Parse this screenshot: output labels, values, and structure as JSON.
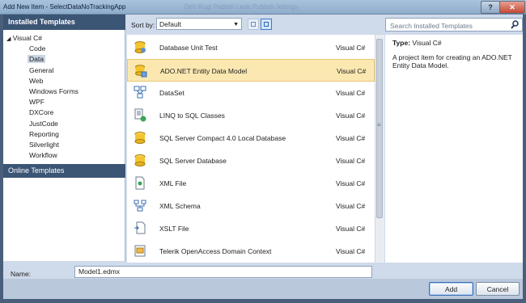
{
  "window": {
    "title": "Add New Item - SelectDataNoTrackingApp",
    "background_text": "Deb Rugi  Pablish  Lede Publish Jettings",
    "help_label": "?",
    "close_label": "✕"
  },
  "left": {
    "installed_header": "Installed Templates",
    "root": "Visual C#",
    "items": [
      "Code",
      "Data",
      "General",
      "Web",
      "Windows Forms",
      "WPF",
      "DXCore",
      "JustCode",
      "Reporting",
      "Silverlight",
      "Workflow"
    ],
    "selected": "Data",
    "online_header": "Online Templates"
  },
  "toolbar": {
    "sort_label": "Sort by:",
    "sort_value": "Default"
  },
  "templates": [
    {
      "name": "Database Unit Test",
      "lang": "Visual C#",
      "icon": "database-unit-test-icon"
    },
    {
      "name": "ADO.NET Entity Data Model",
      "lang": "Visual C#",
      "icon": "entity-data-model-icon"
    },
    {
      "name": "DataSet",
      "lang": "Visual C#",
      "icon": "dataset-icon"
    },
    {
      "name": "LINQ to SQL Classes",
      "lang": "Visual C#",
      "icon": "linq-to-sql-icon"
    },
    {
      "name": "SQL Server Compact 4.0 Local Database",
      "lang": "Visual C#",
      "icon": "database-cylinder-icon"
    },
    {
      "name": "SQL Server Database",
      "lang": "Visual C#",
      "icon": "database-cylinder-icon"
    },
    {
      "name": "XML File",
      "lang": "Visual C#",
      "icon": "xml-file-icon"
    },
    {
      "name": "XML Schema",
      "lang": "Visual C#",
      "icon": "xml-schema-icon"
    },
    {
      "name": "XSLT File",
      "lang": "Visual C#",
      "icon": "xslt-file-icon"
    },
    {
      "name": "Telerik OpenAccess Domain Context",
      "lang": "Visual C#",
      "icon": "telerik-context-icon"
    }
  ],
  "selected_template": 1,
  "search": {
    "placeholder": "Search Installed Templates"
  },
  "description": {
    "type_label": "Type:",
    "type_value": "Visual C#",
    "text": "A project item for creating an ADO.NET Entity Data Model."
  },
  "footer": {
    "name_label": "Name:",
    "name_value": "Model1.edmx",
    "add_label": "Add",
    "cancel_label": "Cancel"
  },
  "colors": {
    "header_bg": "#3b5575",
    "selection": "#fbe8b1",
    "dialog_bg": "#cfdaea"
  }
}
